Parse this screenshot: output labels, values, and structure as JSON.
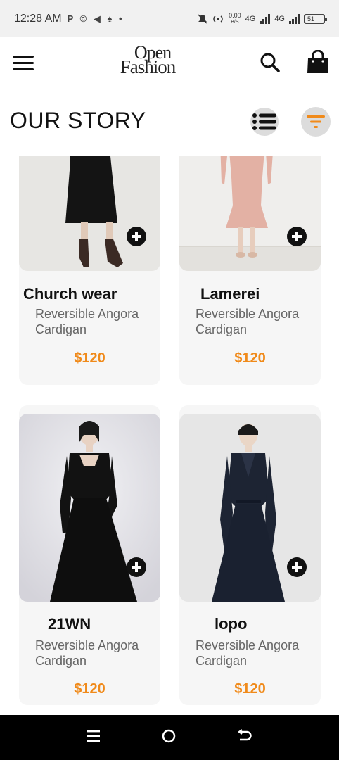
{
  "status_bar": {
    "time": "12:28 AM",
    "app_icons": "P © ◀ ♠ •",
    "net_speed_value": "0.00",
    "net_speed_unit": "B/S",
    "net1": "4G",
    "net2": "4G",
    "battery": "51"
  },
  "header": {
    "logo_line1": "Open",
    "logo_line2": "Fashion"
  },
  "page": {
    "title": "OUR STORY"
  },
  "products": [
    {
      "name": "Church wear",
      "description": "Reversible Angora Cardigan",
      "price": "$120"
    },
    {
      "name": "Lamerei",
      "description": "Reversible Angora Cardigan",
      "price": "$120"
    },
    {
      "name": "21WN",
      "description": "Reversible Angora Cardigan",
      "price": "$120"
    },
    {
      "name": "lopo",
      "description": "Reversible Angora Cardigan",
      "price": "$120"
    }
  ],
  "colors": {
    "accent": "#f08a1a",
    "card_bg": "#f6f6f6",
    "icon_bg": "#dcdcdc"
  },
  "icons": {
    "menu": "menu-icon",
    "search": "search-icon",
    "cart": "shopping-bag-icon",
    "list_view": "list-view-icon",
    "filter": "filter-icon",
    "add": "plus-circle-icon"
  }
}
